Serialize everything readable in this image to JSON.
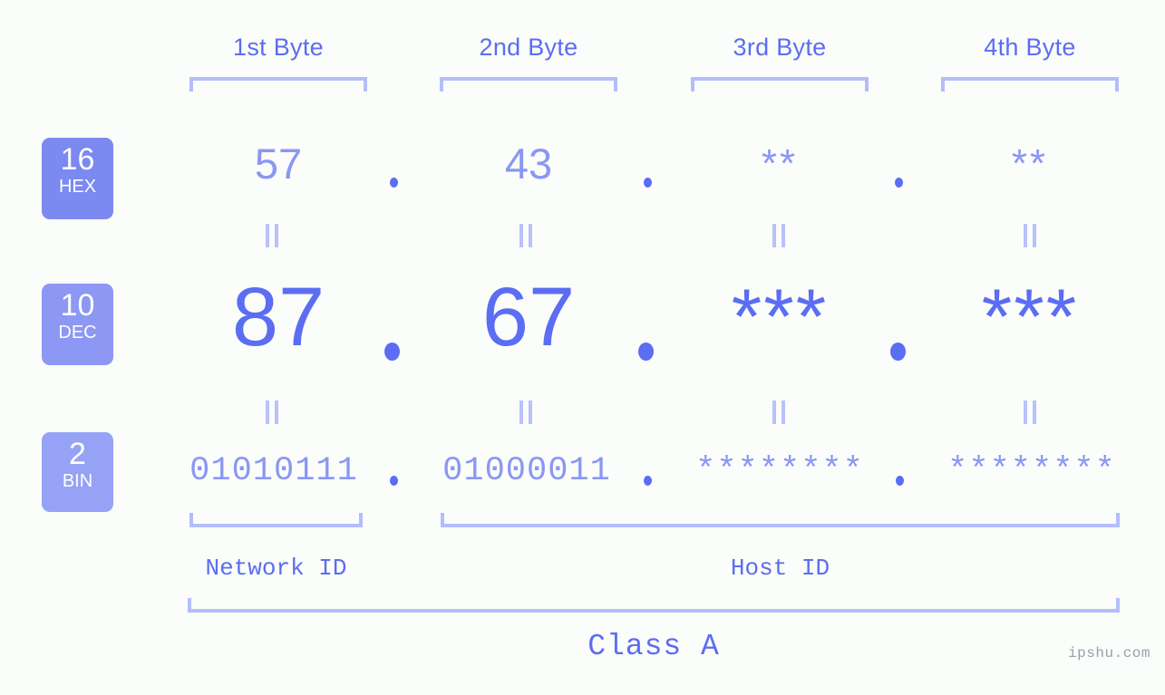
{
  "byte_headers": [
    {
      "label": "1st Byte"
    },
    {
      "label": "2nd Byte"
    },
    {
      "label": "3rd Byte"
    },
    {
      "label": "4th Byte"
    }
  ],
  "bases": [
    {
      "number": "16",
      "abbr": "HEX"
    },
    {
      "number": "10",
      "abbr": "DEC"
    },
    {
      "number": "2",
      "abbr": "BIN"
    }
  ],
  "rows": {
    "hex": {
      "base": "16",
      "abbr": "HEX",
      "values": [
        "57",
        "43",
        "**",
        "**"
      ],
      "separator": "."
    },
    "dec": {
      "base": "10",
      "abbr": "DEC",
      "values": [
        "87",
        "67",
        "***",
        "***"
      ],
      "separator": "."
    },
    "bin": {
      "base": "2",
      "abbr": "BIN",
      "values": [
        "01010111",
        "01000011",
        "********",
        "********"
      ],
      "separator": "."
    }
  },
  "segments": {
    "network_id": "Network ID",
    "host_id": "Host ID"
  },
  "class_label": "Class A",
  "watermark": "ipshu.com",
  "colors": {
    "background": "#fbfdfa",
    "accent_strong": "#5b6df2",
    "accent_light": "#8a97f2",
    "bracket": "#b4bdfb",
    "badge_hex": "#7b89f0",
    "badge_dec": "#8c98f3",
    "badge_bin": "#95a2f5",
    "watermark": "#97a0ad"
  },
  "chart_data": {
    "type": "table",
    "title": "IPv4 address byte breakdown (Class A)",
    "columns": [
      "1st Byte",
      "2nd Byte",
      "3rd Byte",
      "4th Byte"
    ],
    "rows": [
      {
        "base": "16",
        "name": "HEX",
        "values": [
          "57",
          "43",
          "**",
          "**"
        ]
      },
      {
        "base": "10",
        "name": "DEC",
        "values": [
          "87",
          "67",
          "***",
          "***"
        ]
      },
      {
        "base": "2",
        "name": "BIN",
        "values": [
          "01010111",
          "01000011",
          "********",
          "********"
        ]
      }
    ],
    "groupings": [
      {
        "label": "Network ID",
        "bytes": [
          1
        ]
      },
      {
        "label": "Host ID",
        "bytes": [
          2,
          3,
          4
        ]
      },
      {
        "label": "Class A",
        "bytes": [
          1,
          2,
          3,
          4
        ]
      }
    ]
  }
}
